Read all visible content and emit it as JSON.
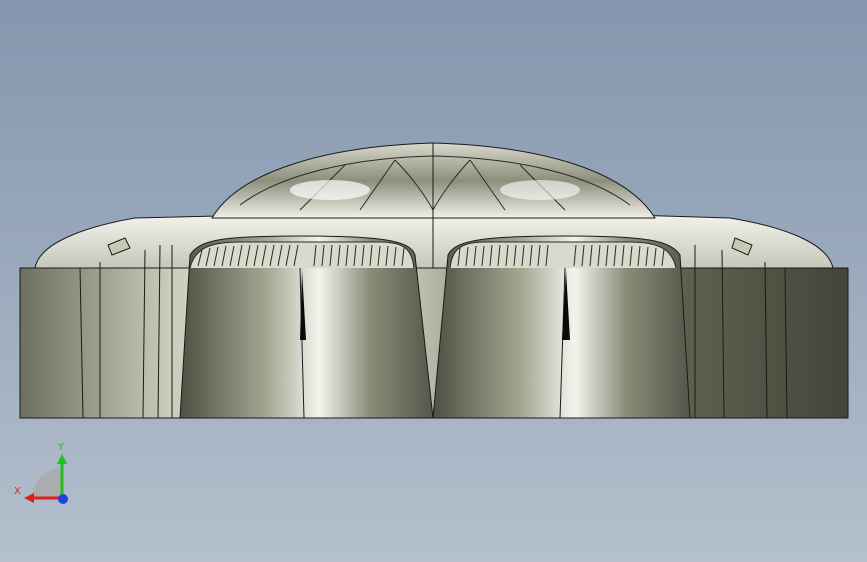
{
  "viewport": {
    "background_top": "#8497ae",
    "background_bottom": "#b5c0cc",
    "model_color": "#8a8b78",
    "edge_color": "#1a1a1a"
  },
  "triad": {
    "x_label": "X",
    "y_label": "Y",
    "x_color": "#e02020",
    "y_color": "#20c020",
    "z_color": "#2040e0",
    "icon": "coordinate-triad-icon"
  }
}
